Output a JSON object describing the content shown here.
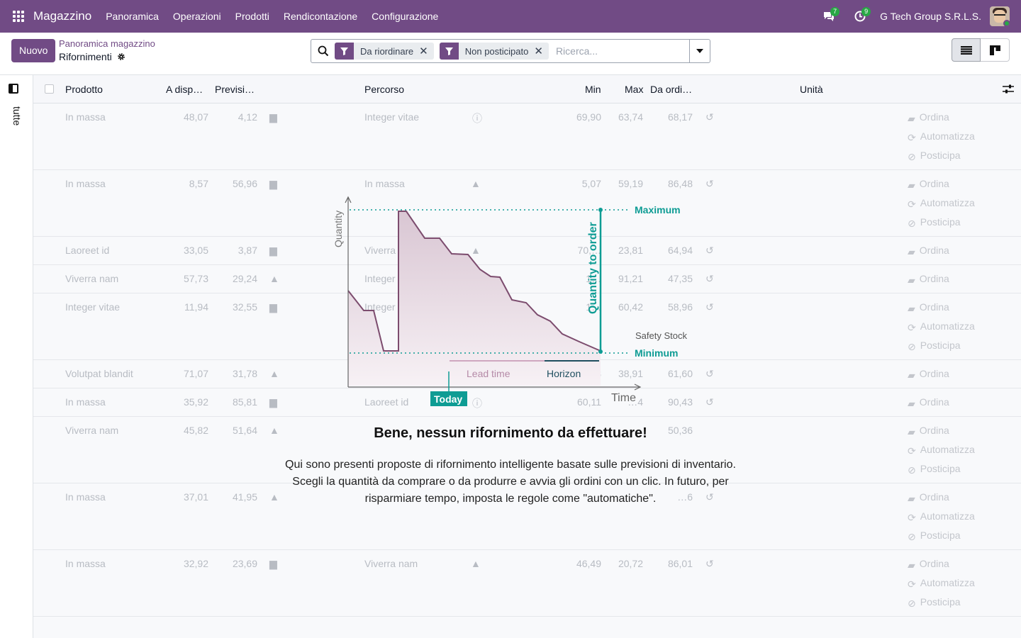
{
  "navbar": {
    "app_name": "Magazzino",
    "menu": [
      "Panoramica",
      "Operazioni",
      "Prodotti",
      "Rendicontazione",
      "Configurazione"
    ],
    "messages_count": "7",
    "activities_count": "9",
    "company": "G Tech Group S.R.L.S."
  },
  "control": {
    "new_label": "Nuovo",
    "breadcrumb": "Panoramica magazzino",
    "title": "Rifornimenti",
    "filters": [
      "Da riordinare",
      "Non posticipato"
    ],
    "search_placeholder": "Ricerca..."
  },
  "side": {
    "label": "tutte"
  },
  "table": {
    "columns": {
      "product": "Prodotto",
      "available": "A disp…",
      "forecast": "Previsi…",
      "route": "Percorso",
      "min": "Min",
      "max": "Max",
      "to_order": "Da ordi…",
      "unit": "Unità"
    },
    "actions": {
      "order": "Ordina",
      "automate": "Automatizza",
      "postpone": "Posticipa"
    },
    "rows": [
      {
        "product": "In massa",
        "available": "48,07",
        "forecast": "4,12",
        "route": "Integer vitae",
        "min": "69,90",
        "max": "63,74",
        "to_order": "68,17"
      },
      {
        "product": "In massa",
        "available": "8,57",
        "forecast": "56,96",
        "route": "In massa",
        "min": "5,07",
        "max": "59,19",
        "to_order": "86,48"
      },
      {
        "product": "Laoreet id",
        "available": "33,05",
        "forecast": "3,87",
        "route": "Viverra nam",
        "min": "70,…",
        "max": "23,81",
        "to_order": "64,94"
      },
      {
        "product": "Viverra nam",
        "available": "57,73",
        "forecast": "29,24",
        "route": "Integer vitae",
        "min": "1…",
        "max": "91,21",
        "to_order": "47,35"
      },
      {
        "product": "Integer vitae",
        "available": "11,94",
        "forecast": "32,55",
        "route": "Integer vitae",
        "min": "1…",
        "max": "60,42",
        "to_order": "58,96"
      },
      {
        "product": "Volutpat blandit",
        "available": "71,07",
        "forecast": "31,78",
        "route": "Laoreet id",
        "min": "…93",
        "max": "38,91",
        "to_order": "61,60"
      },
      {
        "product": "In massa",
        "available": "35,92",
        "forecast": "85,81",
        "route": "Laoreet id",
        "min": "60,11",
        "max": "…4",
        "to_order": "90,43"
      },
      {
        "product": "Viverra nam",
        "available": "45,82",
        "forecast": "51,64",
        "route": "",
        "min": "",
        "max": "",
        "to_order": "50,36"
      },
      {
        "product": "In massa",
        "available": "37,01",
        "forecast": "41,95",
        "route": "",
        "min": "",
        "max": "",
        "to_order": "…6"
      },
      {
        "product": "In massa",
        "available": "32,92",
        "forecast": "23,69",
        "route": "Viverra nam",
        "min": "46,49",
        "max": "20,72",
        "to_order": "86,01"
      }
    ]
  },
  "illustration": {
    "y_axis": "Quantity",
    "x_axis": "Time",
    "maximum": "Maximum",
    "minimum": "Minimum",
    "safety_stock": "Safety Stock",
    "quantity_to_order": "Quantity to order",
    "lead_time": "Lead time",
    "horizon": "Horizon",
    "today": "Today"
  },
  "helper": {
    "title": "Bene, nessun rifornimento da effettuare!",
    "text": "Qui sono presenti proposte di rifornimento intelligente basate sulle previsioni di inventario. Scegli la quantità da comprare o da produrre e avvia gli ordini con un clic. In futuro, per risparmiare tempo, imposta le regole come \"automatiche\"."
  },
  "colors": {
    "brand": "#714b85",
    "teal": "#0e9c94",
    "badge": "#28a745"
  }
}
